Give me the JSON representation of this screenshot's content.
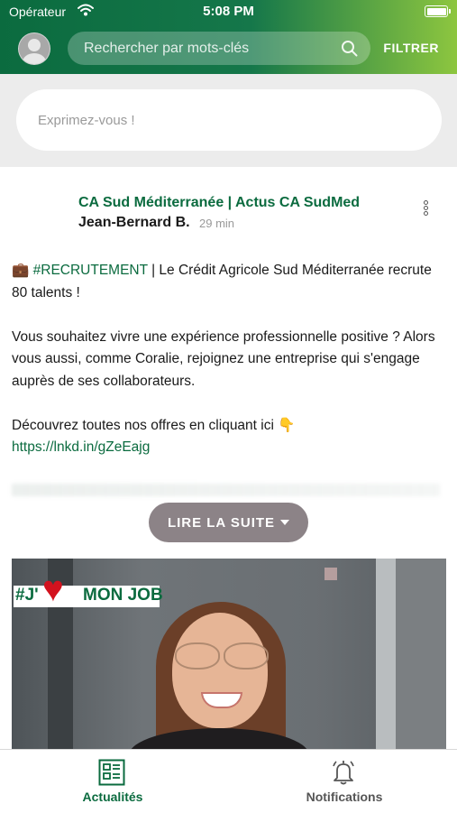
{
  "status_bar": {
    "carrier": "Opérateur",
    "time": "5:08 PM"
  },
  "header": {
    "search_placeholder": "Rechercher par mots-clés",
    "filter_label": "FILTRER"
  },
  "composer": {
    "placeholder": "Exprimez-vous !"
  },
  "post": {
    "source": "CA Sud Méditerranée | Actus CA SudMed",
    "author": "Jean-Bernard B.",
    "time": "29 min",
    "emoji_briefcase": "💼",
    "hashtag": "#RECRUTEMENT",
    "line1_rest": " | Le Crédit Agricole Sud Méditerranée recrute 80 talents !",
    "paragraph2": "Vous souhaitez vivre une expérience professionnelle positive ? Alors vous aussi, comme Coralie, rejoignez une entreprise qui s'engage auprès de ses collaborateurs.",
    "paragraph3": "Découvrez toutes nos offres en cliquant ici 👇",
    "link": "https://lnkd.in/gZeEajg",
    "read_more": "LIRE LA SUITE",
    "image_badge": {
      "prefix": "#J'",
      "heart": "♥",
      "text": "MON JOB"
    }
  },
  "tabs": [
    {
      "label": "Actualités",
      "icon": "newspaper-icon",
      "active": true
    },
    {
      "label": "Notifications",
      "icon": "bell-icon",
      "active": false
    }
  ],
  "colors": {
    "brand_green": "#0b6b3f",
    "accent_lime": "#8dc63f",
    "button_grey": "#8c8387"
  }
}
